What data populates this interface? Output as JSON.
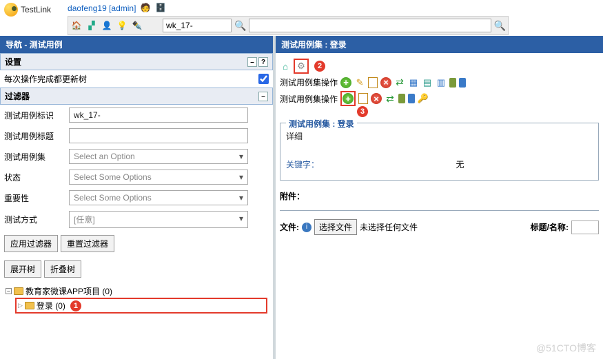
{
  "logo": "TestLink",
  "user": "daofeng19 [admin]",
  "toolbar_search": "wk_17-",
  "left": {
    "title": "导航 - 测试用例",
    "settings": "设置",
    "refresh_label": "每次操作完成都更新树",
    "filters": "过滤器",
    "fields": {
      "id_label": "测试用例标识",
      "id_value": "wk_17-",
      "title_label": "测试用例标题",
      "title_value": "",
      "suite_label": "测试用例集",
      "suite_ph": "Select an Option",
      "status_label": "状态",
      "status_ph": "Select Some Options",
      "importance_label": "重要性",
      "importance_ph": "Select Some Options",
      "method_label": "测试方式",
      "method_ph": "[任意]"
    },
    "apply_filter": "应用过滤器",
    "reset_filter": "重置过滤器",
    "expand": "展开树",
    "collapse": "折叠树",
    "tree": {
      "root": "教育家微课APP项目 (0)",
      "child": "登录 (0)"
    }
  },
  "right": {
    "title": "测试用例集 : 登录",
    "ops1": "测试用例集操作",
    "ops2": "测试用例集操作",
    "suite_legend": "测试用例集 : 登录",
    "detail": "详细",
    "keywords": "关键字：",
    "none": "无",
    "attachments": "附件：",
    "file_label": "文件:",
    "choose_file": "选择文件",
    "no_file": "未选择任何文件",
    "title_name": "标题/名称:"
  },
  "badges": {
    "b1": "1",
    "b2": "2",
    "b3": "3"
  },
  "watermark": "@51CTO博客"
}
